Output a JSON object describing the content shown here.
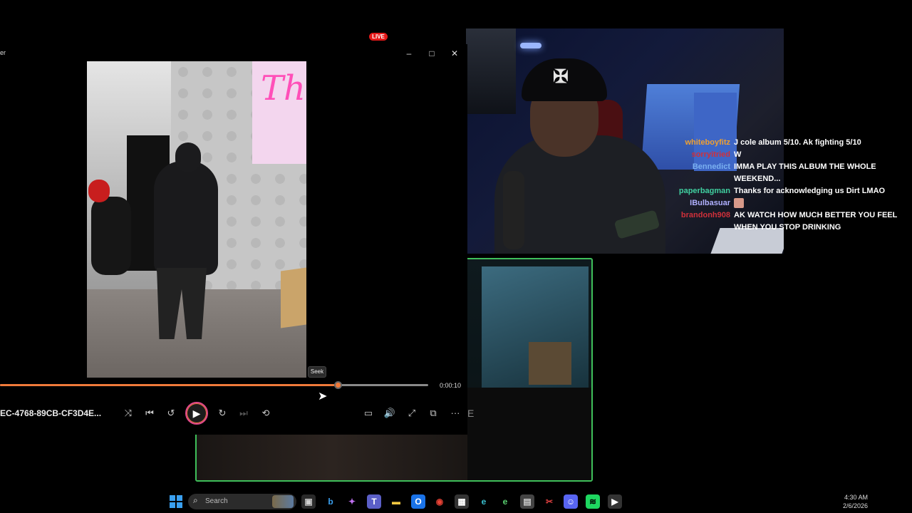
{
  "stream": {
    "live_badge": "LIVE",
    "cap_logo": "✠"
  },
  "chat": {
    "messages": [
      {
        "user": "whiteboyfitz",
        "user_color": "#f0a030",
        "text": "J cole album 5/10. Ak fighting 5/10"
      },
      {
        "user": "sorryitried",
        "user_color": "#d0303a",
        "text": "W"
      },
      {
        "user": "Bennedict",
        "user_color": "#7ab0f0",
        "text": "IMMA PLAY THIS ALBUM THE WHOLE WEEKEND..."
      },
      {
        "user": "paperbagman",
        "user_color": "#40d0a0",
        "text": "Thanks for acknowledging us Dirt LMAO"
      },
      {
        "user": "IBulbasuar",
        "user_color": "#b0b0ff",
        "text": "",
        "emote": true
      },
      {
        "user": "brandonh908",
        "user_color": "#d0303a",
        "text": "AK WATCH HOW MUCH BETTER YOU FEEL WHEN YOU STOP DRINKING"
      }
    ]
  },
  "player": {
    "title_fragment": "er",
    "window_controls": {
      "minimize": "–",
      "maximize": "□",
      "close": "✕"
    },
    "seek_tooltip": "Seek",
    "time": "0:00:10",
    "progress": 0.788,
    "file_name": "EC-4768-89CB-CF3D4E...",
    "sign_text": "Th",
    "controls": {
      "shuffle": "⤨",
      "previous": "⏮",
      "rewind": "↺",
      "play": "▶",
      "forward": "↻",
      "next": "⏭",
      "repeat": "⟲",
      "captions": "▭",
      "volume": "🔊",
      "fullscreen": "⤢",
      "miniplayer": "⧉",
      "more": "···"
    }
  },
  "taskbar": {
    "search_placeholder": "Search",
    "time": "4:30 AM",
    "date": "2/6/2026",
    "icons": [
      {
        "name": "task-view-icon",
        "glyph": "▣",
        "color": "#cfcfcf",
        "bg": "#2a2a2a"
      },
      {
        "name": "bing-icon",
        "glyph": "b",
        "color": "#3aa0f0",
        "bg": "transparent"
      },
      {
        "name": "copilot-icon",
        "glyph": "✦",
        "color": "#c070f0",
        "bg": "transparent"
      },
      {
        "name": "teams-icon",
        "glyph": "T",
        "color": "#fff",
        "bg": "#5b5fc7"
      },
      {
        "name": "file-explorer-icon",
        "glyph": "▬",
        "color": "#f5c842",
        "bg": "transparent"
      },
      {
        "name": "outlook-icon",
        "glyph": "O",
        "color": "#fff",
        "bg": "#1a73e8"
      },
      {
        "name": "chrome-icon",
        "glyph": "◉",
        "color": "#e94235",
        "bg": "transparent"
      },
      {
        "name": "store-icon",
        "glyph": "▦",
        "color": "#fff",
        "bg": "#333"
      },
      {
        "name": "edge-icon",
        "glyph": "e",
        "color": "#3ac0d0",
        "bg": "transparent"
      },
      {
        "name": "edge-beta-icon",
        "glyph": "e",
        "color": "#5ad070",
        "bg": "transparent"
      },
      {
        "name": "calculator-icon",
        "glyph": "▤",
        "color": "#ccc",
        "bg": "#444"
      },
      {
        "name": "snipping-tool-icon",
        "glyph": "✂",
        "color": "#e04040",
        "bg": "transparent"
      },
      {
        "name": "discord-icon",
        "glyph": "☺",
        "color": "#fff",
        "bg": "#5865f2"
      },
      {
        "name": "spotify-icon",
        "glyph": "≋",
        "color": "#000",
        "bg": "#1ed760"
      },
      {
        "name": "media-player-icon",
        "glyph": "▶",
        "color": "#fff",
        "bg": "#333"
      }
    ]
  }
}
